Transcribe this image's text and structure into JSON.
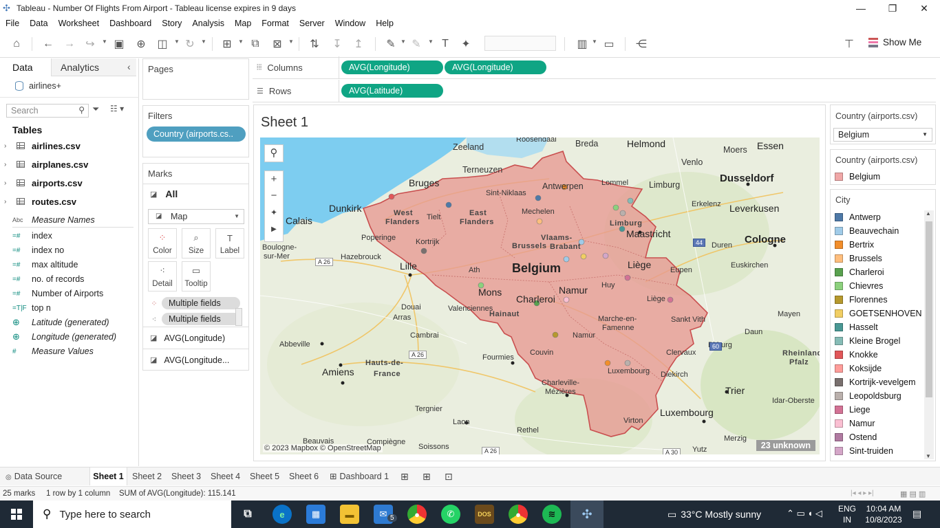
{
  "window": {
    "title": "Tableau - Number Of Flights From Airport - Tableau license expires in 9 days",
    "controls": [
      "—",
      "❐",
      "✕"
    ]
  },
  "menu": [
    "File",
    "Data",
    "Worksheet",
    "Dashboard",
    "Story",
    "Analysis",
    "Map",
    "Format",
    "Server",
    "Window",
    "Help"
  ],
  "toolbar": {
    "show_me": "Show Me"
  },
  "left_pane": {
    "tab_data": "Data",
    "tab_analytics": "Analytics",
    "datasource": "airlines+",
    "search_placeholder": "Search",
    "tables_heading": "Tables",
    "tables": [
      "airlines.csv",
      "airplanes.csv",
      "airports.csv",
      "routes.csv"
    ],
    "fields": [
      {
        "icon": "Abc",
        "name": "Measure Names"
      },
      {
        "icon": "=#",
        "name": "index"
      },
      {
        "icon": "=#",
        "name": "index no"
      },
      {
        "icon": "=#",
        "name": "max altitude"
      },
      {
        "icon": "=#",
        "name": "no. of records"
      },
      {
        "icon": "=#",
        "name": "Number of Airports"
      },
      {
        "icon": "=T|F",
        "name": "top n"
      },
      {
        "icon": "⊕",
        "name": "Latitude (generated)"
      },
      {
        "icon": "⊕",
        "name": "Longitude (generated)"
      },
      {
        "icon": "#",
        "name": "Measure Values"
      }
    ]
  },
  "shelves": {
    "pages_title": "Pages",
    "filters_title": "Filters",
    "filter_pill": "Country (airports.cs..",
    "marks_title": "Marks",
    "marks_all": "All",
    "mark_type": "Map",
    "mark_buttons": [
      "Color",
      "Size",
      "Label",
      "Detail",
      "Tooltip"
    ],
    "mark_fields": [
      "Multiple fields",
      "Multiple fields"
    ],
    "mark_layers": [
      "AVG(Longitude)",
      "AVG(Longitude..."
    ],
    "columns_label": "Columns",
    "rows_label": "Rows",
    "columns_pills": [
      "AVG(Longitude)",
      "AVG(Longitude)"
    ],
    "rows_pills": [
      "AVG(Latitude)"
    ]
  },
  "sheet": {
    "title": "Sheet 1",
    "map_credit": "© 2023 Mapbox © OpenStreetMap",
    "unknown_badge": "23 unknown",
    "map_labels": {
      "belgium": "Belgium",
      "cities": [
        "Zeeland",
        "Roosendaal",
        "Breda",
        "Helmond",
        "Essen",
        "Moers",
        "Terneuzen",
        "Venlo",
        "Bruges",
        "Antwerpen",
        "Lommel",
        "Sint-Niklaas",
        "Limburg",
        "Dusseldorf",
        "Dunkirk",
        "Leverkusen",
        "Erkelenz",
        "Calais",
        "West",
        "Flanders",
        "Tielt",
        "East",
        "Flanders",
        "Mechelen",
        "Limburg",
        "Boulogne-",
        "sur-Mer",
        "Poperinge",
        "Kortrijk",
        "Vlaams-",
        "Brabant",
        "Maastricht",
        "Cologne",
        "Brussels",
        "Duren",
        "Hazebrouck",
        "Lille",
        "Liège",
        "Euskirchen",
        "Ath",
        "Eupen",
        "Huy",
        "Mons",
        "Namur",
        "Douai",
        "Charleroi",
        "Liège",
        "Valenciennes",
        "Hainaut",
        "Arras",
        "Marche-en-",
        "Famenne",
        "Sankt Vith",
        "Mayen",
        "Cambrai",
        "Daun",
        "Abbeville",
        "Couvin",
        "Namur",
        "Clervaux",
        "Fourmies",
        "Bitburg",
        "Hauts-de-",
        "France",
        "Diekirch",
        "Rheinland",
        "Pfalz",
        "Amiens",
        "Luxembourg",
        "Charleville-",
        "Mézières",
        "Trier",
        "Idar-Oberste",
        "Tergnier",
        "Luxembourg",
        "Laon",
        "Virton",
        "Rethel",
        "Merzig",
        "Beauvais",
        "Compiègne",
        "Soissons",
        "Yutz"
      ],
      "roads": [
        "A 26",
        "A 26",
        "44",
        "60",
        "A 26",
        "A 30"
      ]
    }
  },
  "right_pane": {
    "filter_title": "Country (airports.csv)",
    "filter_value": "Belgium",
    "legend1_title": "Country (airports.csv)",
    "legend1_items": [
      {
        "name": "Belgium",
        "color": "#f0a7a7"
      }
    ],
    "legend2_title": "City",
    "legend2_items": [
      {
        "name": "Antwerp",
        "color": "#4e79a7"
      },
      {
        "name": "Beauvechain",
        "color": "#a0cbe8"
      },
      {
        "name": "Bertrix",
        "color": "#f28e2b"
      },
      {
        "name": "Brussels",
        "color": "#ffbe7d"
      },
      {
        "name": "Charleroi",
        "color": "#59a14f"
      },
      {
        "name": "Chievres",
        "color": "#8cd17d"
      },
      {
        "name": "Florennes",
        "color": "#b6992d"
      },
      {
        "name": "GOETSENHOVEN",
        "color": "#f1ce63"
      },
      {
        "name": "Hasselt",
        "color": "#499894"
      },
      {
        "name": "Kleine Brogel",
        "color": "#86bcb6"
      },
      {
        "name": "Knokke",
        "color": "#e15759"
      },
      {
        "name": "Koksijde",
        "color": "#ff9d9a"
      },
      {
        "name": "Kortrijk-vevelgem",
        "color": "#79706e"
      },
      {
        "name": "Leopoldsburg",
        "color": "#bab0ac"
      },
      {
        "name": "Liege",
        "color": "#d37295"
      },
      {
        "name": "Namur",
        "color": "#fabfd2"
      },
      {
        "name": "Ostend",
        "color": "#b07aa1"
      },
      {
        "name": "Sint-truiden",
        "color": "#d4a6c8"
      }
    ]
  },
  "tabs": {
    "data_source": "Data Source",
    "sheets": [
      "Sheet 1",
      "Sheet 2",
      "Sheet 3",
      "Sheet 4",
      "Sheet 5",
      "Sheet 6"
    ],
    "dashboard": "Dashboard 1",
    "active": "Sheet 1"
  },
  "status": {
    "marks": "25 marks",
    "rows_cols": "1 row by 1 column",
    "sum": "SUM of AVG(Longitude): 115.141"
  },
  "taskbar": {
    "search_placeholder": "Type here to search",
    "weather": "33°C  Mostly sunny",
    "lang_top": "ENG",
    "lang_bottom": "IN",
    "time": "10:04 AM",
    "date": "10/8/2023",
    "mail_badge": "5"
  }
}
